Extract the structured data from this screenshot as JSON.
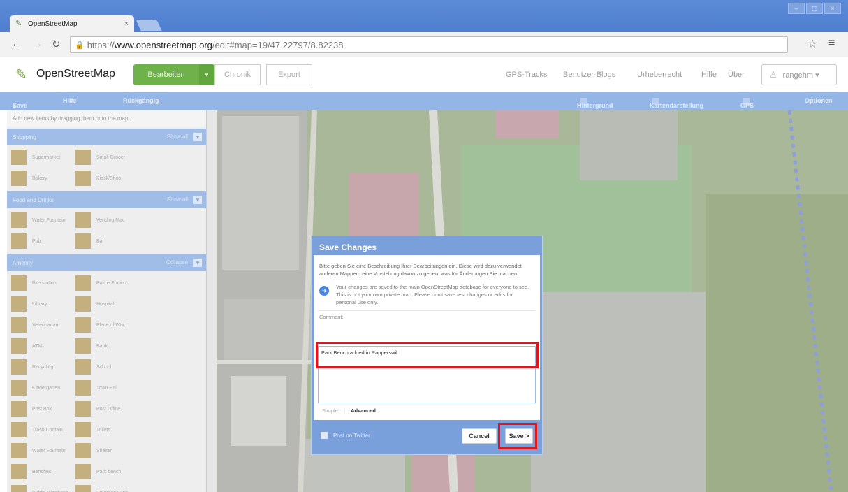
{
  "browser": {
    "tab_title": "OpenStreetMap",
    "tab_close": "×",
    "url_prefix": "https://",
    "url_domain": "www.openstreetmap.org",
    "url_path": "/edit#map=19/47.22797/8.82238",
    "win_controls": [
      "–",
      "▢",
      "×"
    ]
  },
  "header": {
    "brand": "OpenStreetMap",
    "edit_label": "Bearbeiten",
    "edit_arrow": "▾",
    "history_label": "Chronik",
    "export_label": "Export",
    "links": [
      "GPS-Tracks",
      "Benutzer-Blogs",
      "Urheberrecht",
      "Hilfe",
      "Über"
    ],
    "user": "rangehm ▾"
  },
  "id_toolbar": {
    "save": "Save",
    "help": "Hilfe",
    "undo": "Rückgängig",
    "background": "Hintergrund",
    "map_data": "Kartendarstellung",
    "gps": "GPS-Daten",
    "options": "Optionen"
  },
  "sidebar": {
    "hint": "Add new items by dragging them onto the map.",
    "categories": [
      {
        "name": "Shopping",
        "action": "Show all",
        "items": [
          {
            "label": "Supermarket",
            "icon": "cart-icon"
          },
          {
            "label": "Small Grocer",
            "icon": "basket-icon"
          },
          {
            "label": "Bakery",
            "icon": "bread-icon"
          },
          {
            "label": "Kiosk/Shop",
            "icon": "shop-icon"
          }
        ]
      },
      {
        "name": "Food and Drinks",
        "action": "Show all",
        "items": [
          {
            "label": "Water Fountain",
            "icon": "fountain-icon"
          },
          {
            "label": "Vending Mac",
            "icon": "vending-icon"
          },
          {
            "label": "Pub",
            "icon": "beer-icon"
          },
          {
            "label": "Bar",
            "icon": "cocktail-icon"
          }
        ]
      },
      {
        "name": "Amenity",
        "action": "Collapse",
        "items": [
          {
            "label": "Fire station",
            "icon": "fire-icon"
          },
          {
            "label": "Police Station",
            "icon": "police-icon"
          },
          {
            "label": "Library",
            "icon": "library-icon"
          },
          {
            "label": "Hospital",
            "icon": "hospital-icon"
          },
          {
            "label": "Veterinarian",
            "icon": "vet-icon"
          },
          {
            "label": "Place of Wor.",
            "icon": "worship-icon"
          },
          {
            "label": "ATM",
            "icon": "atm-icon"
          },
          {
            "label": "Bank",
            "icon": "bank-icon"
          },
          {
            "label": "Recycling",
            "icon": "recycling-icon"
          },
          {
            "label": "School",
            "icon": "school-icon"
          },
          {
            "label": "Kindergarten",
            "icon": "kindergarten-icon"
          },
          {
            "label": "Town Hall",
            "icon": "townhall-icon"
          },
          {
            "label": "Post Box",
            "icon": "postbox-icon"
          },
          {
            "label": "Post Office",
            "icon": "postoffice-icon"
          },
          {
            "label": "Trash Contain.",
            "icon": "trash-icon"
          },
          {
            "label": "Toilets",
            "icon": "toilets-icon"
          },
          {
            "label": "Water Fountain",
            "icon": "fountain-icon"
          },
          {
            "label": "Shelter",
            "icon": "shelter-icon"
          },
          {
            "label": "Benches",
            "icon": "bench-icon"
          },
          {
            "label": "Park bench",
            "icon": "bench-icon"
          },
          {
            "label": "Public telephone",
            "icon": "telephone-icon"
          },
          {
            "label": "Emergency ph.",
            "icon": "emergency-phone-icon"
          }
        ]
      }
    ]
  },
  "dialog": {
    "title": "Save Changes",
    "intro": "Bitte geben Sie eine Beschreibung Ihrer Bearbeitungen ein. Diese wird dazu verwendet, anderen Mappern eine Vorstellung davon zu geben, was für Änderungen Sie machen.",
    "notice_icon": "➜",
    "notice": "Your changes are saved to the main OpenStreetMap database for everyone to see. This is not your own private map. Please don't save test changes or edits for personal use only.",
    "comment_label": "Comment:",
    "comment_value": "Park Bench added in Rapperswil",
    "tab_simple": "Simple",
    "tab_sep": "|",
    "tab_advanced": "Advanced",
    "twitter": "Post on Twitter",
    "cancel": "Cancel",
    "save": "Save >"
  },
  "colors": {
    "osm_green": "#6fb14b",
    "id_blue": "#7aa0dc",
    "highlight_red": "#e0161b"
  }
}
